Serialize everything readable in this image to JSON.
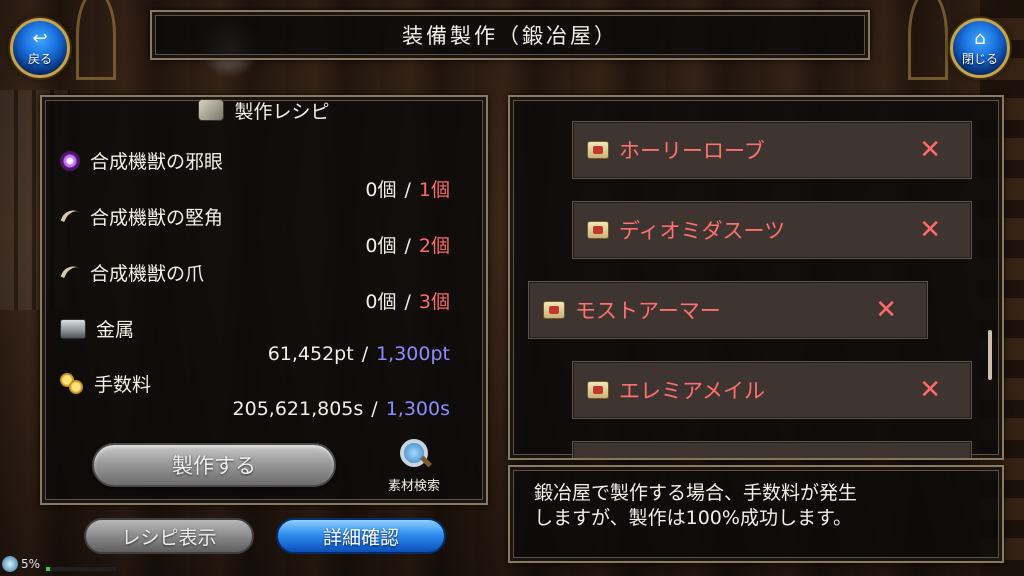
{
  "title": "装備製作（鍛冶屋）",
  "nav": {
    "back_label": "戻る",
    "close_label": "閉じる"
  },
  "recipe": {
    "header": "製作レシピ",
    "materials": [
      {
        "icon": "evil-eye-icon",
        "name": "合成機獣の邪眼",
        "have": "0個",
        "need": "1個",
        "need_color": "#ff6b6b"
      },
      {
        "icon": "horn-icon",
        "name": "合成機獣の堅角",
        "have": "0個",
        "need": "2個",
        "need_color": "#ff6b6b"
      },
      {
        "icon": "claw-icon",
        "name": "合成機獣の爪",
        "have": "0個",
        "need": "3個",
        "need_color": "#ff6b6b"
      }
    ],
    "metal": {
      "icon": "metal-ingot-icon",
      "name": "金属",
      "have": "61,452pt",
      "need": "1,300pt",
      "need_color": "#8e8cff"
    },
    "fee": {
      "icon": "coins-icon",
      "name": "手数料",
      "have": "205,621,805s",
      "need": "1,300s",
      "need_color": "#8e8cff"
    },
    "separator": "/",
    "craft_button": "製作する",
    "search_button": "素材検索"
  },
  "bottom": {
    "recipe_view_button": "レシピ表示",
    "detail_button": "詳細確認"
  },
  "status": {
    "battery": "5%",
    "battery_level": 0.05
  },
  "equipment_list": [
    {
      "name": "ホーリーローブ",
      "mark": "✕",
      "selected": false
    },
    {
      "name": "ディオミダスーツ",
      "mark": "✕",
      "selected": false
    },
    {
      "name": "モストアーマー",
      "mark": "✕",
      "selected": true
    },
    {
      "name": "エレミアメイル",
      "mark": "✕",
      "selected": false
    }
  ],
  "info_text_line1": "鍛冶屋で製作する場合、手数料が発生",
  "info_text_line2": "しますが、製作は100%成功します。",
  "colors": {
    "need_insufficient": "#ff6b6b",
    "need_resource": "#8e8cff",
    "item_name": "#ff7070",
    "accent_blue": "#2f8ef0"
  }
}
